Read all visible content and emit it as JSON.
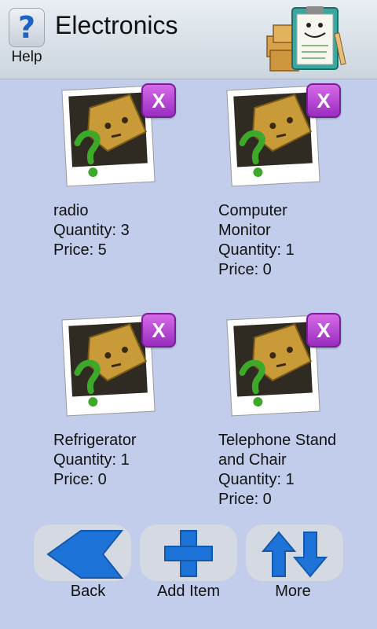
{
  "header": {
    "help_label": "Help",
    "help_icon": "question-mark-icon",
    "title": "Electronics",
    "mascot": "clipboard-mascot-with-boxes"
  },
  "items": [
    {
      "name": "radio",
      "quantity": "Quantity: 3",
      "price": "Price: 5",
      "remove_label": "X"
    },
    {
      "name": "Computer Monitor",
      "quantity": "Quantity: 1",
      "price": "Price: 0",
      "remove_label": "X"
    },
    {
      "name": "Refrigerator",
      "quantity": "Quantity: 1",
      "price": "Price: 0",
      "remove_label": "X"
    },
    {
      "name": "Telephone Stand and Chair",
      "quantity": "Quantity: 1",
      "price": "Price: 0",
      "remove_label": "X"
    }
  ],
  "toolbar": {
    "back_label": "Back",
    "add_label": "Add Item",
    "more_label": "More"
  },
  "colors": {
    "background": "#c1cdeb",
    "remove_button": "#b13fd6",
    "toolbar_icon": "#1e73d8"
  }
}
